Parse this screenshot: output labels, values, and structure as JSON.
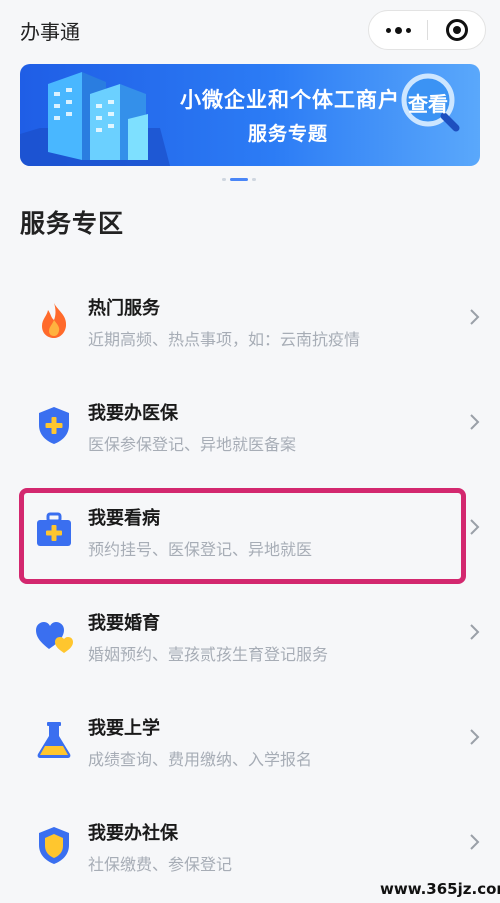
{
  "header": {
    "title": "办事通"
  },
  "banner": {
    "line1": "小微企业和个体工商户",
    "line2": "服务专题",
    "badge": "查看"
  },
  "section": {
    "title": "服务专区"
  },
  "items": [
    {
      "title": "热门服务",
      "subtitle": "近期高频、热点事项，如：云南抗疫情",
      "icon": "flame-icon"
    },
    {
      "title": "我要办医保",
      "subtitle": "医保参保登记、异地就医备案",
      "icon": "shield-plus-icon"
    },
    {
      "title": "我要看病",
      "subtitle": "预约挂号、医保登记、异地就医",
      "icon": "medical-kit-icon"
    },
    {
      "title": "我要婚育",
      "subtitle": "婚姻预约、壹孩贰孩生育登记服务",
      "icon": "hearts-icon"
    },
    {
      "title": "我要上学",
      "subtitle": "成绩查询、费用缴纳、入学报名",
      "icon": "flask-icon"
    },
    {
      "title": "我要办社保",
      "subtitle": "社保缴费、参保登记",
      "icon": "shield-icon"
    }
  ],
  "watermark": "www.365jz.com",
  "colors": {
    "accent": "#3a6ff0",
    "highlight": "#d3286f",
    "banner": "#2c7cf5"
  }
}
